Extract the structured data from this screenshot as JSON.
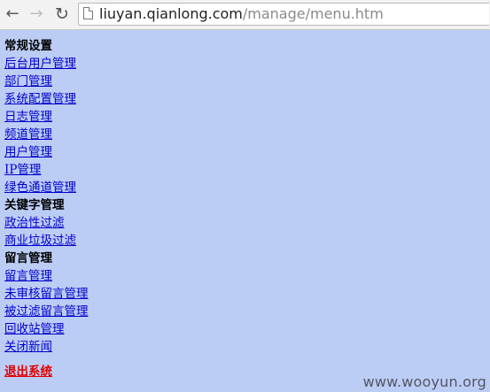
{
  "browser": {
    "back_icon": "back-arrow-icon",
    "forward_icon": "forward-arrow-icon",
    "reload_icon": "reload-icon",
    "url_host": "liuyan.qianlong.com",
    "url_path": "/manage/menu.htm"
  },
  "menu": {
    "sections": [
      {
        "heading": "常规设置",
        "items": [
          "后台用户管理",
          "部门管理",
          "系统配置管理",
          "日志管理",
          "频道管理",
          "用户管理",
          "IP管理",
          "绿色通道管理"
        ]
      },
      {
        "heading": "关键字管理",
        "items": [
          "政治性过滤",
          "商业垃圾过滤"
        ]
      },
      {
        "heading": "留言管理",
        "items": [
          "留言管理",
          "未审核留言管理",
          "被过滤留言管理",
          "回收站管理",
          "关闭新闻"
        ]
      }
    ],
    "logout_label": "退出系统"
  },
  "watermark": "www.wooyun.org",
  "colors": {
    "page_background": "#bccdf5",
    "link": "#0000cc",
    "logout": "#e00000"
  }
}
